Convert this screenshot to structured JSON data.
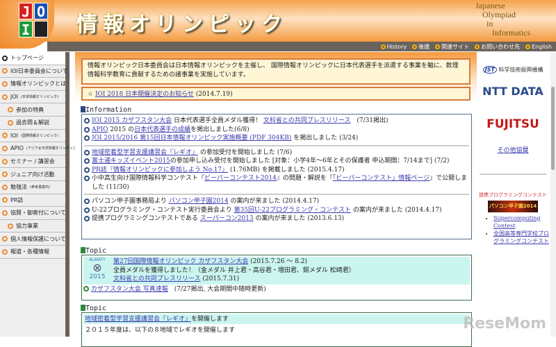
{
  "header": {
    "logo_letters": [
      "J",
      "O",
      "I"
    ],
    "title": "情報オリンピック",
    "english_title": [
      "Japanese",
      "Olympiad",
      "in",
      "Informatics"
    ]
  },
  "nav": [
    "History",
    "後援",
    "関連サイト",
    "お問い合わせ先",
    "English"
  ],
  "sidebar": [
    {
      "label": "トップページ",
      "note": ""
    },
    {
      "label": "IOI日本委員会について",
      "note": ""
    },
    {
      "label": "情報オリンピックとは",
      "note": ""
    },
    {
      "label": "JOI",
      "note": "(日本情報オリンピック)"
    },
    {
      "label": "参加の特典",
      "note": "",
      "sub": true
    },
    {
      "label": "過去問＆解説",
      "note": "",
      "sub": true
    },
    {
      "label": "IOI",
      "note": "(国際情報オリンピック)"
    },
    {
      "label": "APIO",
      "note": "(アジア太平洋情報オリンピック)"
    },
    {
      "label": "セミナー / 講習会",
      "note": ""
    },
    {
      "label": "ジュニア向け活動",
      "note": ""
    },
    {
      "label": "勉強法",
      "note": "(参考書案内)"
    },
    {
      "label": "PR誌",
      "note": ""
    },
    {
      "label": "協賛・御寄付について",
      "note": ""
    },
    {
      "label": "協力事業",
      "note": "",
      "sub": true
    },
    {
      "label": "個人情報保護について",
      "note": ""
    },
    {
      "label": "報道・各種情報",
      "note": ""
    }
  ],
  "intro": "情報オリンピック日本委員会は日本情報オリンピックを主催し、 国際情報オリンピックに日本代表選手を派遣する事業を軸に、数理情報科学教育に貢献するための諸事業を実施しています。",
  "notice": {
    "star": "☆",
    "link": "IOI 2018 日本開催決定のお知らせ",
    "date": "(2014.7.19)"
  },
  "information": {
    "heading": "Information",
    "groups": [
      [
        {
          "link": "IOI 2015 カザフスタン大会",
          "text": " 日本代表選手全員メダル獲得！ ",
          "link2": "文科省との共同プレスリリース",
          "tail": "　(7/31掲出)"
        },
        {
          "pre": "",
          "link": "APIO",
          "text": " 2015 の",
          "link2": "日本代表選手の成績",
          "tail": "を掲出しました(6/8)"
        },
        {
          "link": "JOI 2015/2016 第15回日本情報オリンピック実施概要 (PDF 304KB)",
          "text": " を掲出しました (3/24)"
        }
      ],
      [
        {
          "link": "地域密着型学習支援講習会『レギオ』",
          "text": " の参加受付を開始しました (7/6)"
        },
        {
          "link": "富士通キッズイベント2015",
          "text": "の参加申し込み受付を開始しました [対象：小学4年〜6年とその保護者 申込期間：7/14まで] (7/2)"
        },
        {
          "link": "PR誌『情報オリンピックに参加しよう No.17』",
          "text": " (1.76MB) を掲載しました (2015.4.17)"
        },
        {
          "pre": "小中高生向け国際情報科学コンテスト『",
          "link": "ビーバーコンテスト2014",
          "text": "』の問題・解説を『",
          "link2": "「ビーバーコンテスト」情報ページ",
          "tail": "』で公開しました (11/30)"
        }
      ],
      [
        {
          "pre": "パソコン甲子園事務局より ",
          "link": "パソコン甲子園2014",
          "text": " の案内が来ました (2014.4.17)"
        },
        {
          "pre": "U-22プログラミング・コンテスト実行委員会より ",
          "link": "第35回U-22プログラミング・コンテスト",
          "text": " の案内が来ました (2014.4.17)"
        },
        {
          "pre": "提携プログラミングコンテストである ",
          "link": "スーパーコン2013",
          "text": " の案内が来ました (2013.6.13)"
        }
      ]
    ]
  },
  "topic1": {
    "heading": "Topic",
    "badge": [
      "ALMATY",
      "2015"
    ],
    "link": "第27回国際情報オリンピック カザフスタン大会",
    "date": " (2015.7.26 〜 8.2)",
    "line2": "全員メダルを獲得しました！（金メダル 井上君・高谷君・増田君、銅メダル 松崎君）",
    "link2": "文科省との共同プレスリリース",
    "date2": " (2015.7.31)",
    "link3": "カザフスタン大会 写真速報",
    "tail3": "　(7/27掲出, 大会期間中随時更新)"
  },
  "topic2": {
    "heading": "Topic",
    "link": "地域密着型学習支援講習会『レギオ』",
    "text": "を開催します",
    "line2": "２０１５年度は、以下の８地域でレギオを開催します"
  },
  "right": {
    "sponsors": [
      "科学技術振興機構",
      "NTT DATA",
      "FUJITSU"
    ],
    "jst": "JST",
    "other": "その他協賛",
    "contest_heading": "提携プログラミングコンテスト",
    "banner": "パソコン甲子園2014",
    "links": [
      "Supercomputing Contest",
      "全国高等専門学校プログラミングコンテスト"
    ]
  },
  "watermark": "ReseMom",
  "colors": {
    "orange": "#f49a3e",
    "navbar": "#6a625c",
    "cyan": "#cbf5ef"
  }
}
